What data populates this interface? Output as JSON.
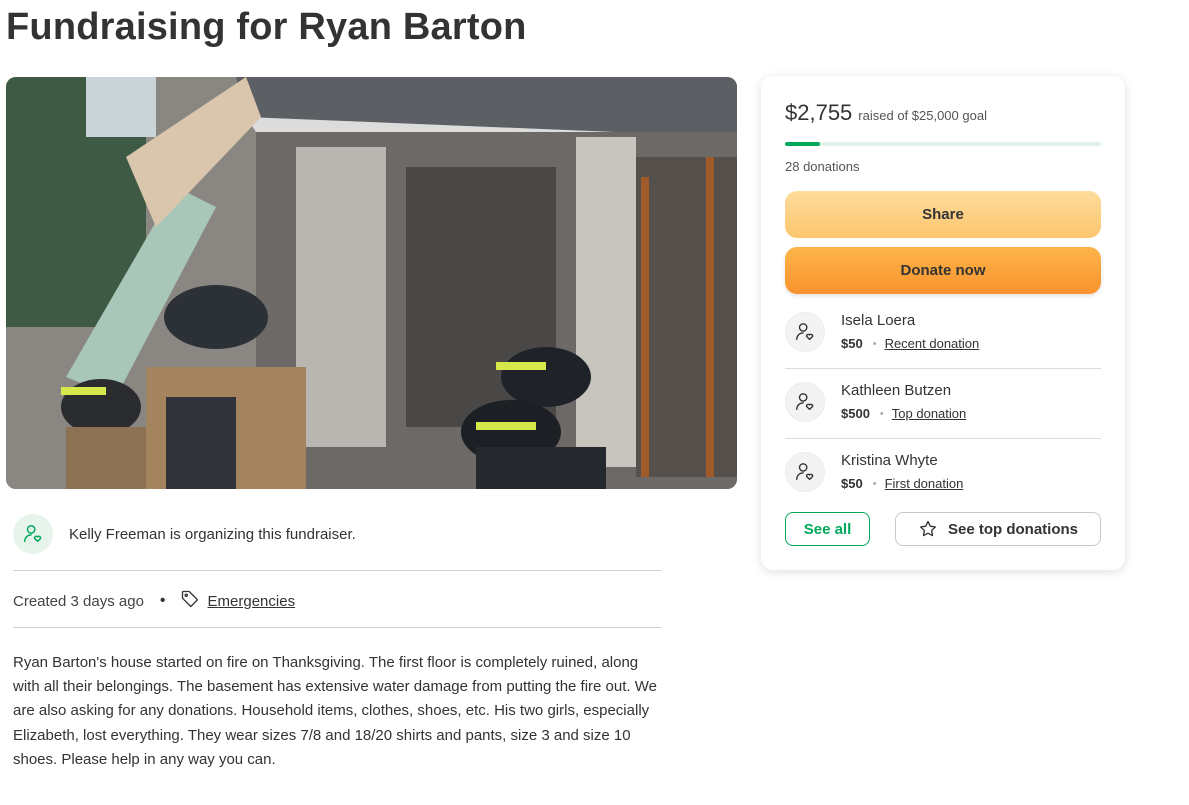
{
  "page": {
    "title": "Fundraising for Ryan Barton"
  },
  "organizer": {
    "text": "Kelly Freeman is organizing this fundraiser."
  },
  "meta": {
    "created": "Created 3 days ago",
    "separator": "•",
    "category": "Emergencies"
  },
  "story": "Ryan Barton's house started on fire on Thanksgiving. The first floor is completely ruined, along with all their belongings. The basement has extensive water damage from putting the fire out. We are also asking for any donations. Household items, clothes, shoes, etc. His two girls, especially Elizabeth, lost everything. They wear sizes 7/8 and 18/20 shirts and pants, size 3 and size 10 shoes. Please help in any way you can.",
  "donation_card": {
    "raised_amount": "$2,755",
    "goal_text": "raised of $25,000 goal",
    "progress_fraction": 0.11,
    "donation_count": "28 donations",
    "share_label": "Share",
    "donate_label": "Donate now",
    "donors": [
      {
        "name": "Isela Loera",
        "amount": "$50",
        "type": "Recent donation"
      },
      {
        "name": "Kathleen Butzen",
        "amount": "$500",
        "type": "Top donation"
      },
      {
        "name": "Kristina Whyte",
        "amount": "$50",
        "type": "First donation"
      }
    ],
    "see_all_label": "See all",
    "see_top_label": "See top donations"
  },
  "colors": {
    "brand_green": "#02a95c",
    "donate_orange": "#f9922d",
    "share_yellow": "#fcc66e"
  },
  "icons": {
    "organizer": "user-heart-icon",
    "donor": "user-heart-icon",
    "tag": "tag-icon",
    "star": "star-icon"
  }
}
